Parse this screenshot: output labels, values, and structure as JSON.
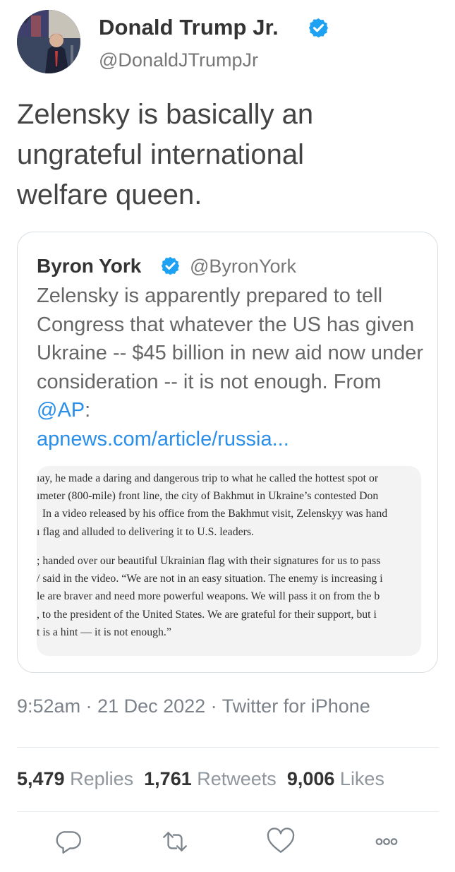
{
  "tweet": {
    "author": {
      "name": "Donald Trump Jr.",
      "handle": "@DonaldJTrumpJr",
      "verified": true,
      "verified_color": "#1da1f2"
    },
    "text": "Zelensky is basically an\nungrateful international\nwelfare queen.",
    "quoted": {
      "name": "Byron York",
      "handle": "@ByronYork",
      "verified": true,
      "text": "Zelensky is apparently prepared to tell Congress that whatever the US has given Ukraine -- $45 billion in new aid now under consideration -- it is not enough. From ",
      "mention": "@AP",
      "mention_suffix": ":",
      "link": "apnews.com/article/russia...",
      "link_color": "#2b8ee8",
      "article_excerpt": {
        "paragraph1": "ıay, he made a daring and dangerous trip to what he called the hottest spot or\nımeter (800-mile) front line, the city of Bakhmut in Ukraine’s contested Don\n  In a video released by his office from the Bakhmut visit, Zelenskyy was hand\nı flag and alluded to delivering it to U.S. leaders.",
        "paragraph2": "; handed over our beautiful Ukrainian flag with their signatures for us to pass\n/ said in the video. “We are not in an easy situation. The enemy is increasing i\nle are braver and need more powerful weapons. We will pass it on from the b\n, to the president of the United States. We are grateful for their support, but i\nt is a hint — it is not enough.”"
      }
    },
    "meta": "9:52am · 21 Dec 2022 · Twitter for iPhone",
    "stats": {
      "replies_count": "5,479",
      "replies_label": "Replies",
      "retweets_count": "1,761",
      "retweets_label": "Retweets",
      "likes_count": "9,006",
      "likes_label": "Likes"
    },
    "actions": [
      {
        "icon": "reply-icon"
      },
      {
        "icon": "retweet-icon"
      },
      {
        "icon": "heart-icon"
      },
      {
        "icon": "more-icon"
      }
    ]
  }
}
